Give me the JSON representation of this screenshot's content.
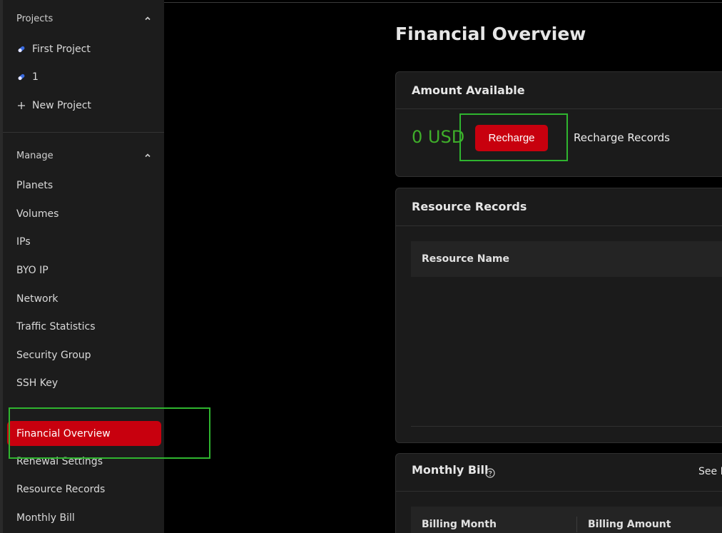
{
  "sidebar": {
    "projects_header": "Projects",
    "projects": [
      {
        "label": "First Project",
        "icon": "project-pill-icon"
      },
      {
        "label": "1",
        "icon": "project-pill-icon"
      }
    ],
    "new_project_label": "New Project",
    "manage_header": "Manage",
    "manage_items": [
      "Planets",
      "Volumes",
      "IPs",
      "BYO IP",
      "Network",
      "Traffic Statistics",
      "Security Group",
      "SSH Key"
    ],
    "active_item": "Financial Overview",
    "billing_items": [
      "Renewal Settings",
      "Resource Records",
      "Monthly Bill"
    ]
  },
  "main": {
    "page_title": "Financial Overview",
    "amount_card": {
      "title": "Amount Available",
      "amount": "0 USD",
      "recharge_label": "Recharge",
      "records_label": "Recharge Records"
    },
    "resource_card": {
      "title": "Resource Records",
      "columns": [
        "Resource Name"
      ]
    },
    "monthly_card": {
      "title": "Monthly Bill",
      "see_more_label": "See M",
      "columns": [
        "Billing Month",
        "Billing Amount"
      ]
    }
  },
  "colors": {
    "accent_red": "#c8000e",
    "amount_green": "#3fae2a",
    "highlight_green": "#2fb52f",
    "sidebar_bg": "#1c1c1c"
  }
}
